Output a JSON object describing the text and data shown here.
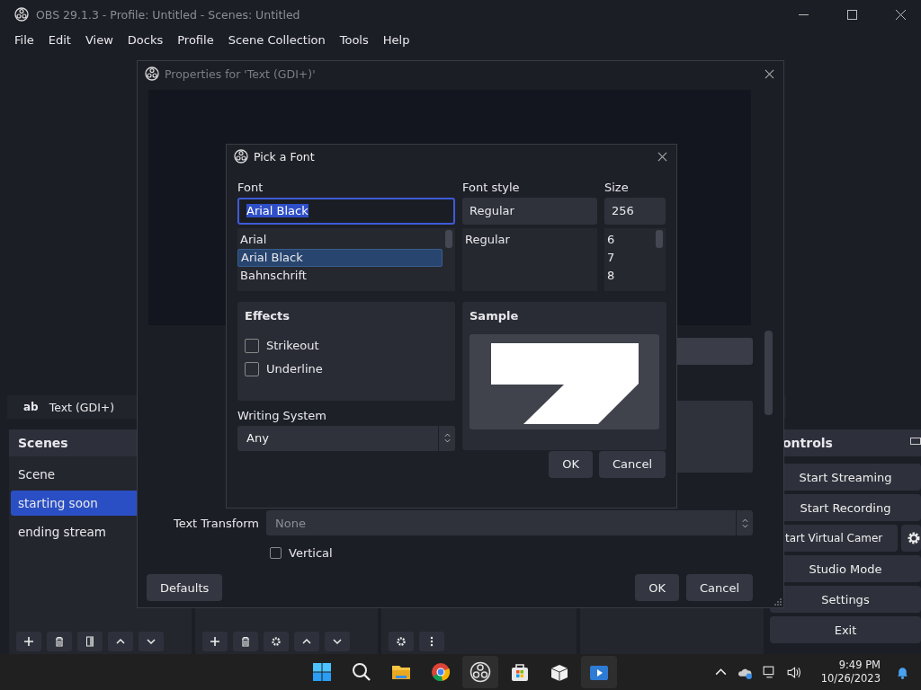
{
  "main_window": {
    "title": "OBS 29.1.3 - Profile: Untitled - Scenes: Untitled",
    "menu": [
      "File",
      "Edit",
      "View",
      "Docks",
      "Profile",
      "Scene Collection",
      "Tools",
      "Help"
    ]
  },
  "source_bar": {
    "icon_text": "ab",
    "label": "Text (GDI+)"
  },
  "scenes_dock": {
    "title": "Scenes",
    "items": [
      {
        "label": "Scene",
        "selected": false
      },
      {
        "label": "starting soon",
        "selected": true
      },
      {
        "label": "ending stream",
        "selected": false
      }
    ]
  },
  "controls_dock": {
    "title": "ontrols",
    "buttons": [
      "Start Streaming",
      "Start Recording",
      "tart Virtual Camer",
      "Studio Mode",
      "Settings",
      "Exit"
    ]
  },
  "properties_dialog": {
    "title": "Properties for 'Text (GDI+)'",
    "text_transform": {
      "label": "Text Transform",
      "value": "None"
    },
    "vertical": {
      "label": "Vertical",
      "checked": false
    },
    "defaults": "Defaults",
    "ok": "OK",
    "cancel": "Cancel"
  },
  "font_dialog": {
    "title": "Pick a Font",
    "font": {
      "label": "Font",
      "value": "Arial Black",
      "items": [
        {
          "label": "Arial",
          "selected": false
        },
        {
          "label": "Arial Black",
          "selected": true
        },
        {
          "label": "Bahnschrift",
          "selected": false
        }
      ]
    },
    "style": {
      "label": "Font style",
      "value": "Regular",
      "items": [
        "Regular"
      ]
    },
    "size": {
      "label": "Size",
      "value": "256",
      "items": [
        "6",
        "7",
        "8"
      ]
    },
    "effects": {
      "title": "Effects",
      "options": [
        {
          "label": "Strikeout",
          "checked": false
        },
        {
          "label": "Underline",
          "checked": false
        }
      ]
    },
    "writing_system": {
      "label": "Writing System",
      "value": "Any"
    },
    "sample": {
      "title": "Sample"
    },
    "ok": "OK",
    "cancel": "Cancel"
  },
  "taskbar": {
    "time": "9:49 PM",
    "date": "10/26/2023"
  }
}
